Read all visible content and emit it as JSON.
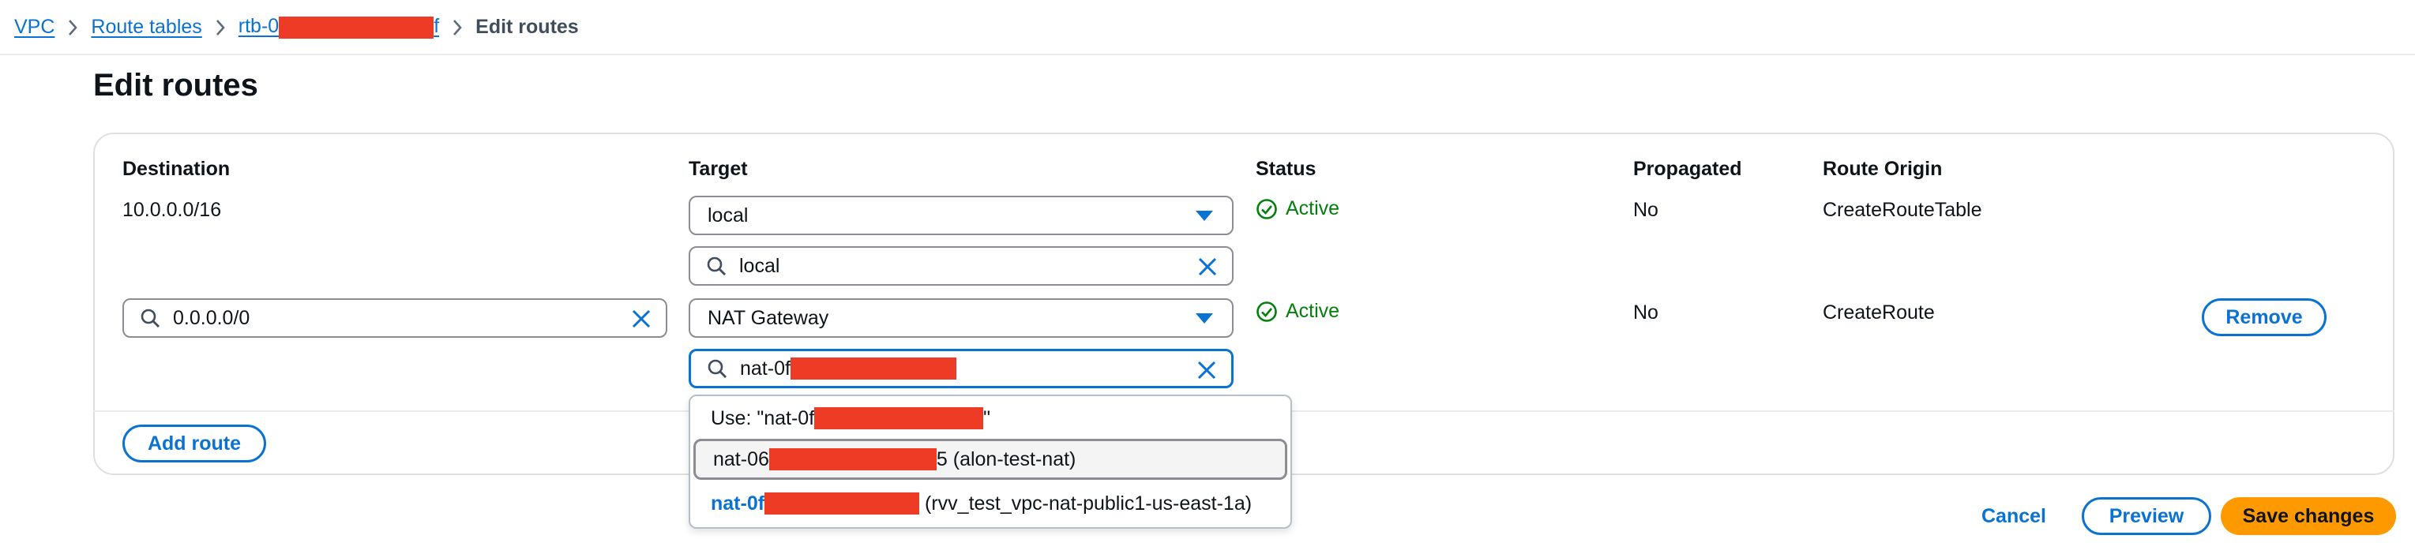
{
  "breadcrumb": {
    "vpc": "VPC",
    "route_tables": "Route tables",
    "rtb_prefix": "rtb-0",
    "rtb_suffix": "f",
    "current": "Edit routes"
  },
  "page": {
    "title": "Edit routes"
  },
  "columns": {
    "destination": "Destination",
    "target": "Target",
    "status": "Status",
    "propagated": "Propagated",
    "route_origin": "Route Origin"
  },
  "routes": [
    {
      "destination": "10.0.0.0/16",
      "target_type": "local",
      "target_search": "local",
      "status": "Active",
      "propagated": "No",
      "origin": "CreateRouteTable"
    },
    {
      "destination": "0.0.0.0/0",
      "target_type": "NAT Gateway",
      "target_search": "nat-0f",
      "status": "Active",
      "propagated": "No",
      "origin": "CreateRoute",
      "remove_label": "Remove"
    }
  ],
  "dropdown": {
    "use_prefix": "Use: \"nat-0f",
    "use_suffix": "\"",
    "options": [
      {
        "id_prefix": "nat-06",
        "id_suffix": "5",
        "name": "(alon-test-nat)"
      },
      {
        "id_prefix": "nat-0f",
        "id_suffix": "",
        "name": "(rvv_test_vpc-nat-public1-us-east-1a)"
      }
    ]
  },
  "actions": {
    "add_route": "Add route",
    "cancel": "Cancel",
    "preview": "Preview",
    "save": "Save changes"
  },
  "colors": {
    "link": "#0972d3",
    "success": "#037f0c",
    "primary": "#ff9900",
    "redaction": "#ee3b26"
  }
}
